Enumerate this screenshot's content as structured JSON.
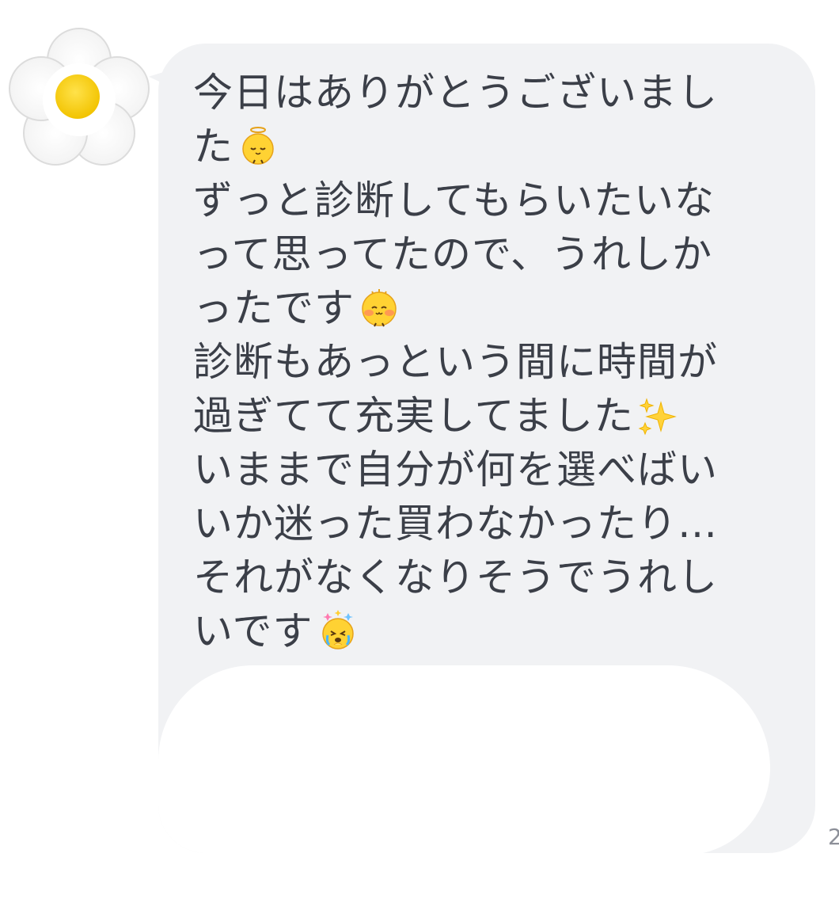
{
  "message": {
    "sender_avatar_icon": "daisy-flower-icon",
    "bubble_color": "#f1f2f4",
    "text_color": "#3b3f48",
    "lines": [
      {
        "text": "今日はありがとうございまし",
        "emoji": null
      },
      {
        "text": "た",
        "emoji": "chick-halo-icon"
      },
      {
        "text": "ずっと診断してもらいたいな",
        "emoji": null
      },
      {
        "text": "って思ってたので、うれしか",
        "emoji": null
      },
      {
        "text": "ったです",
        "emoji": "chick-blush-icon"
      },
      {
        "text": "診断もあっという間に時間が",
        "emoji": null
      },
      {
        "text": "過ぎてて充実してました",
        "emoji": "sparkles-icon"
      },
      {
        "text": "いままで自分が何を選べばい",
        "emoji": null
      },
      {
        "text": "いか迷った買わなかったり…",
        "emoji": null
      },
      {
        "text": "それがなくなりそうでうれし",
        "emoji": null
      },
      {
        "text": "いです",
        "emoji": "chick-crying-icon"
      }
    ],
    "timestamp": "2"
  }
}
